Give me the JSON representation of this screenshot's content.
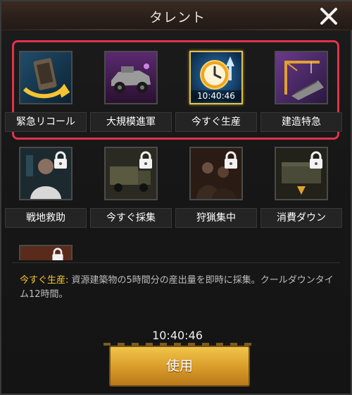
{
  "window": {
    "title": "タレント"
  },
  "talents_row1": [
    {
      "label": "緊急リコール",
      "icon": "recall-icon"
    },
    {
      "label": "大規模進軍",
      "icon": "vehicle-icon"
    },
    {
      "label": "今すぐ生産",
      "icon": "clock-production-icon",
      "timer": "10:40:46"
    },
    {
      "label": "建造特急",
      "icon": "crane-build-icon"
    }
  ],
  "talents_row2": [
    {
      "label": "戦地救助",
      "icon": "medic-icon"
    },
    {
      "label": "今すぐ採集",
      "icon": "truck-icon"
    },
    {
      "label": "狩猟集中",
      "icon": "hunters-icon"
    },
    {
      "label": "消費ダウン",
      "icon": "supply-crates-icon"
    }
  ],
  "description": {
    "name": "今すぐ生産",
    "sep": ": ",
    "text": "資源建築物の5時間分の産出量を即時に採集。クールダウンタイム12時間。"
  },
  "timer": "10:40:46",
  "use_button": "使用",
  "colors": {
    "highlight": "#e3314a",
    "accent": "#f4c430",
    "button": "#e0a838"
  }
}
